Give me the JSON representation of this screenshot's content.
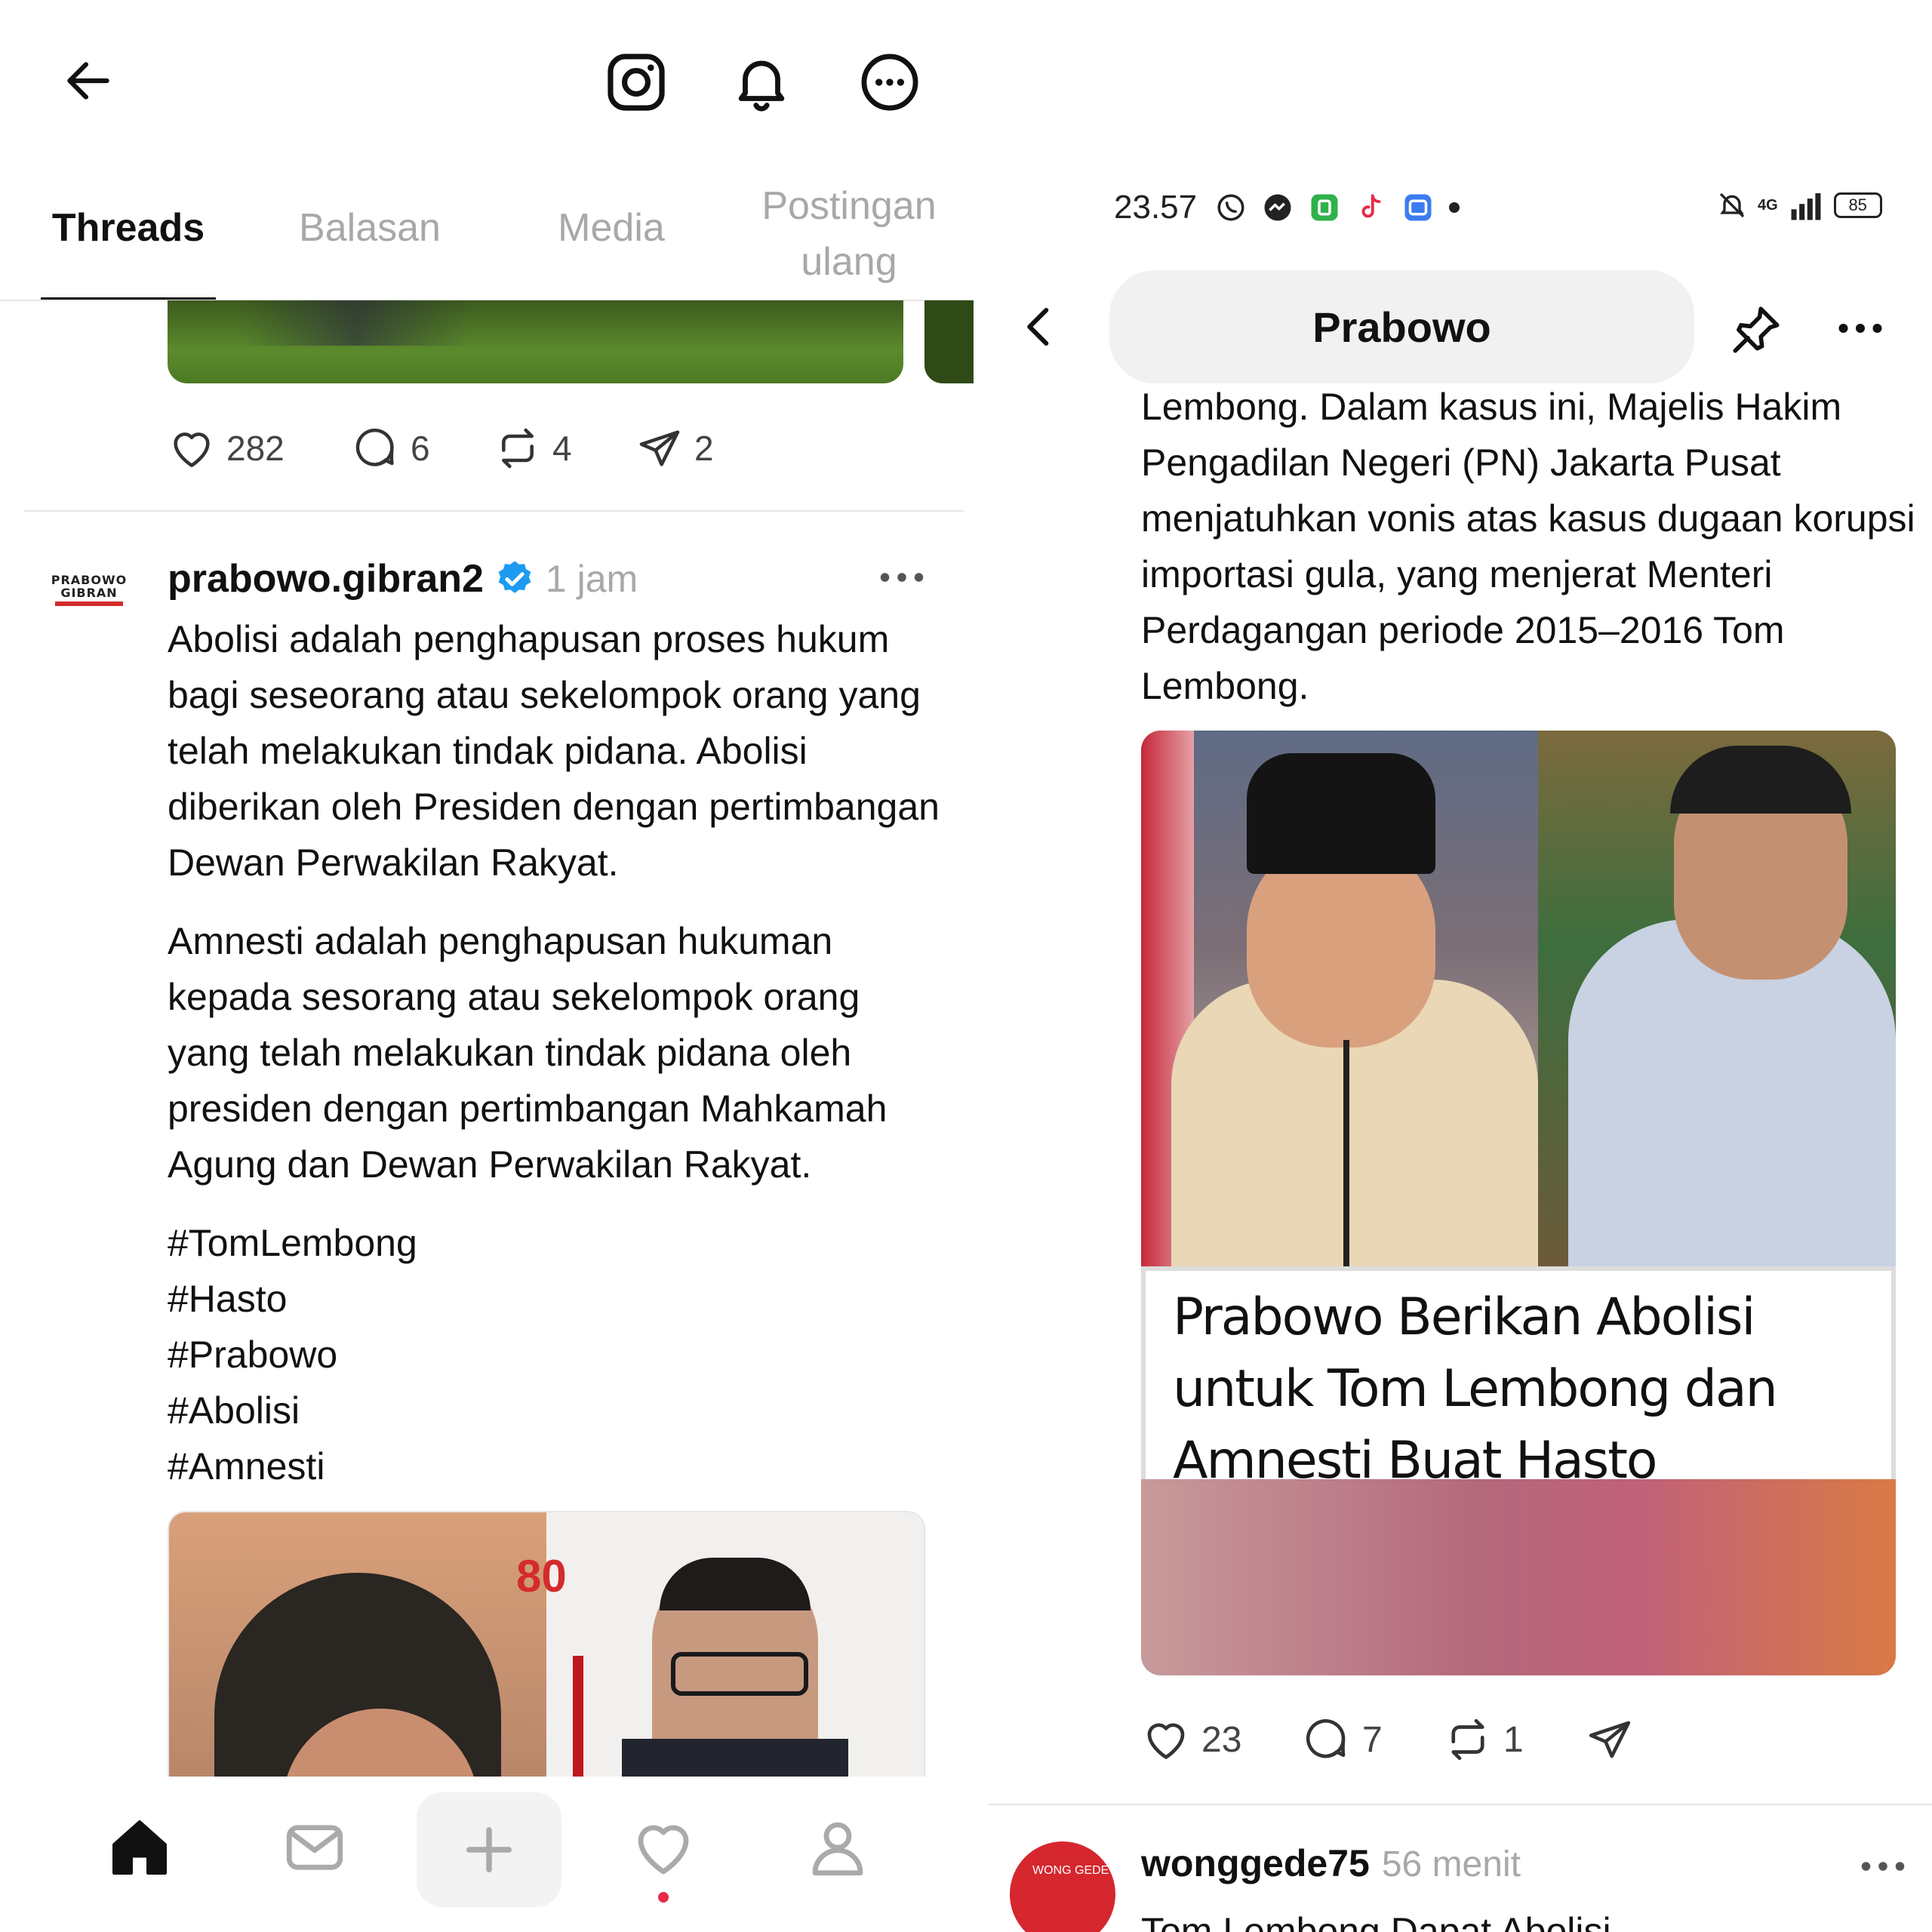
{
  "left": {
    "tabs": [
      {
        "label": "Threads",
        "active": true
      },
      {
        "label": "Balasan",
        "active": false
      },
      {
        "label": "Media",
        "active": false
      },
      {
        "label_lines": [
          "Postingan",
          "ulang"
        ],
        "active": false
      }
    ],
    "prev_post_stats": {
      "likes": "282",
      "replies": "6",
      "reposts": "4",
      "shares": "2"
    },
    "post": {
      "avatar_text_1": "PRABOWO",
      "avatar_text_2": "GIBRAN",
      "username": "prabowo.gibran2",
      "verified": true,
      "time": "1 jam",
      "paragraph1": "Abolisi adalah penghapusan proses hukum bagi seseorang atau sekelompok orang yang telah melakukan tindak pidana. Abolisi diberikan oleh Presiden dengan pertimbangan Dewan Perwakilan Rakyat.",
      "paragraph2": "Amnesti adalah penghapusan hukuman kepada sesorang atau sekelompok orang yang telah melakukan tindak pidana oleh presiden dengan pertimbangan Mahkamah Agung dan Dewan Perwakilan Rakyat.",
      "hashtags": [
        "#TomLembong",
        "#Hasto",
        "#Prabowo",
        "#Abolisi",
        "#Amnesti"
      ],
      "image_badge": "80"
    },
    "bottom_nav": [
      "home-icon",
      "inbox-icon",
      "plus-icon",
      "heart-icon",
      "profile-icon"
    ]
  },
  "right": {
    "status_bar": {
      "time": "23.57",
      "network": "4G",
      "battery": "85"
    },
    "header": {
      "title": "Prabowo"
    },
    "post_text": "Lembong. Dalam kasus ini, Majelis Hakim Pengadilan Negeri (PN) Jakarta Pusat menjatuhkan vonis atas kasus dugaan korupsi importasi gula, yang menjerat Menteri Perdagangan periode 2015–2016 Tom Lembong.",
    "image_caption": [
      "Prabowo Berikan Abolisi",
      "untuk Tom Lembong dan",
      "Amnesti Buat Hasto Kristiyanto"
    ],
    "stats": {
      "likes": "23",
      "replies": "7",
      "reposts": "1"
    },
    "next_post": {
      "username": "wonggede75",
      "time": "56 menit",
      "preview": "Tom Lembong Dapat Abolisi",
      "avatar_text": "WONG GEDE"
    }
  },
  "colors": {
    "verified": "#1d9bf0",
    "muted": "#a8a8a8",
    "notification_dot": "#e8294a"
  }
}
